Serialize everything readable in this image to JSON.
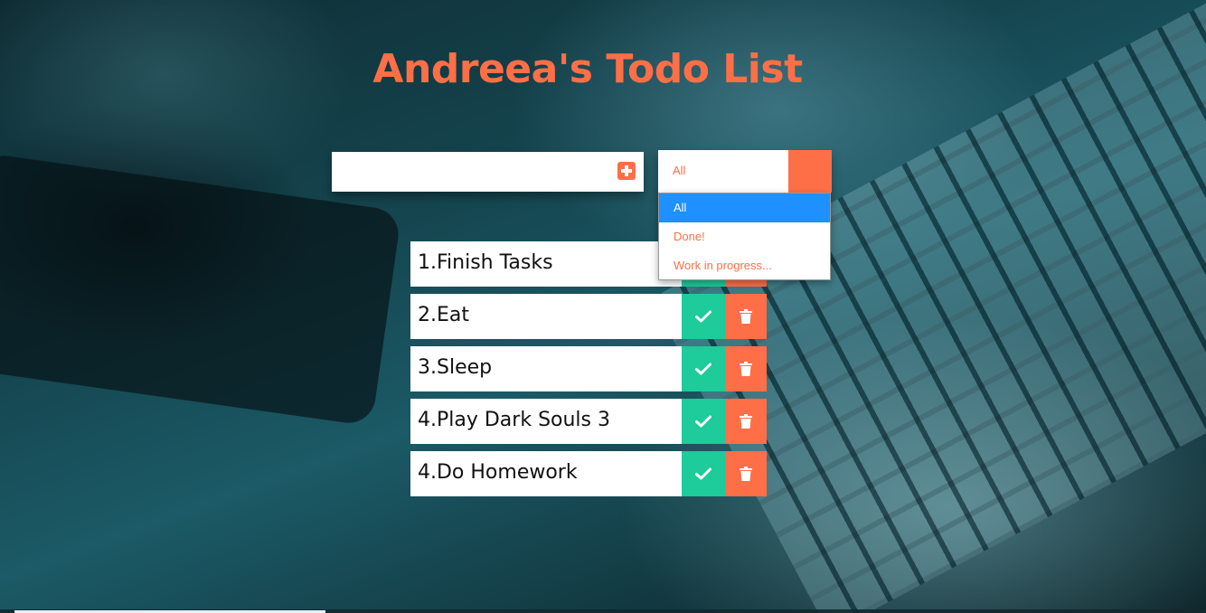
{
  "app": {
    "title": "Andreea's Todo List"
  },
  "input": {
    "value": "",
    "placeholder": ""
  },
  "filter": {
    "selected": "All",
    "options": [
      "All",
      "Done!",
      "Work in progress..."
    ]
  },
  "todos": [
    {
      "text": "1.Finish Tasks"
    },
    {
      "text": "2.Eat"
    },
    {
      "text": "3.Sleep"
    },
    {
      "text": "4.Play Dark Souls 3"
    },
    {
      "text": "4.Do Homework"
    }
  ],
  "icons": {
    "add": "plus-square-icon",
    "complete": "check-icon",
    "delete": "trash-icon"
  },
  "colors": {
    "accent": "#ff6f47",
    "complete": "#1ecb9a",
    "selected_option": "#1e90ff"
  }
}
